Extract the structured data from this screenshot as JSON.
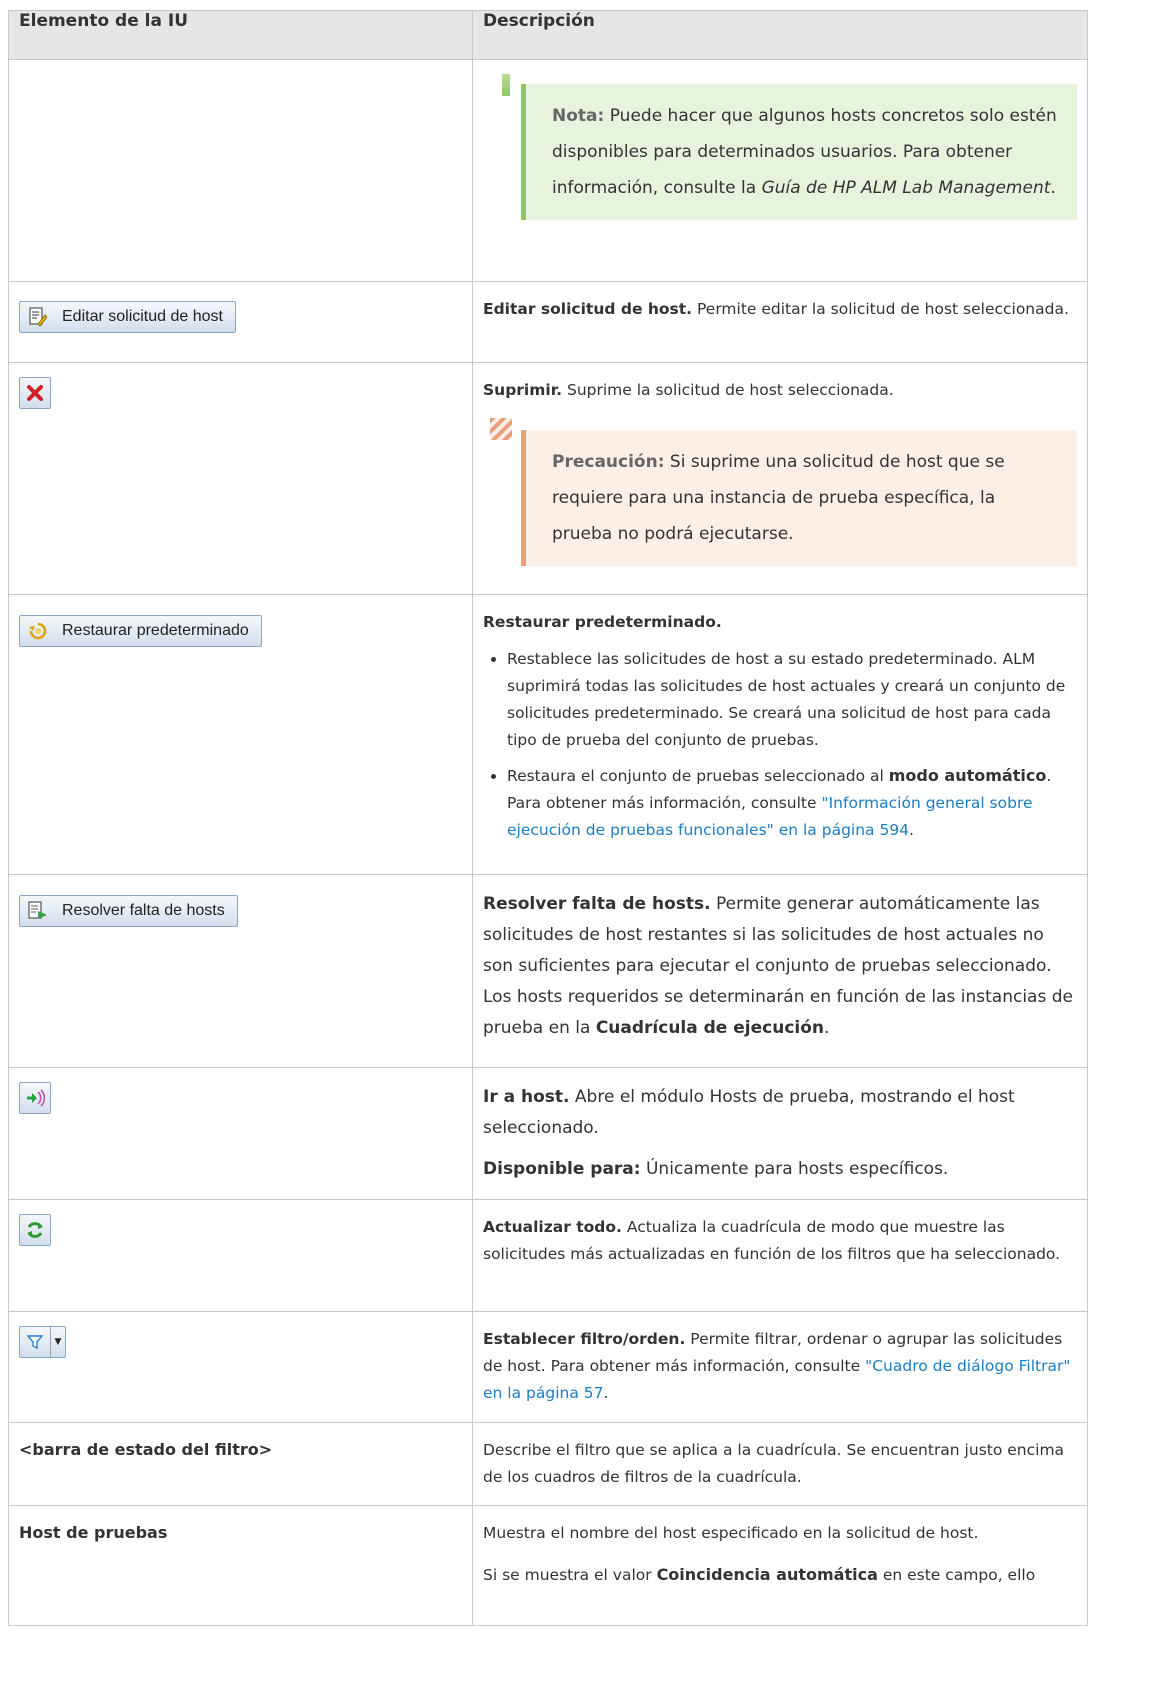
{
  "table": {
    "header": {
      "col1": "Elemento de la IU",
      "col2": "Descripción"
    },
    "note": {
      "label": "Nota:",
      "text1": "Puede hacer que algunos hosts concretos solo estén disponibles para determinados usuarios. Para obtener información, consulte la",
      "guide": "Guía de HP ALM Lab Management",
      "text2": "."
    },
    "edit": {
      "button_label": "Editar solicitud de host",
      "title": "Editar solicitud de host.",
      "text": "Permite editar la solicitud de host seleccionada."
    },
    "delete": {
      "title": "Suprimir.",
      "text": "Suprime la solicitud de host seleccionada.",
      "caution_label": "Precaución:",
      "caution_text": "Si suprime una solicitud de host que se requiere para una instancia de prueba específica, la prueba no podrá ejecutarse."
    },
    "restore": {
      "button_label": "Restaurar predeterminado",
      "title": "Restaurar predeterminado.",
      "bullet1": "Restablece las solicitudes de host a su estado predeterminado. ALM suprimirá todas las solicitudes de host actuales y creará un conjunto de solicitudes predeterminado. Se creará una solicitud de host para cada tipo de prueba del conjunto de pruebas.",
      "bullet2_pre": "Restaura el conjunto de pruebas seleccionado al",
      "bullet2_bold": "modo automático",
      "bullet2_mid": ". Para obtener más información, consulte",
      "bullet2_link": "\"Información general sobre ejecución de pruebas funcionales\" en la página 594",
      "bullet2_end": "."
    },
    "resolve": {
      "button_label": "Resolver falta de hosts",
      "title": "Resolver falta de hosts.",
      "text": "Permite generar automáticamente las solicitudes de host restantes si las solicitudes de host actuales no son suficientes para ejecutar el conjunto de pruebas seleccionado. Los hosts requeridos se determinarán en función de las instancias de prueba en la",
      "bold": "Cuadrícula de ejecución",
      "end": "."
    },
    "goto": {
      "title": "Ir a host.",
      "text": "Abre el módulo Hosts de prueba, mostrando el host seleccionado.",
      "avail_label": "Disponible para:",
      "avail_text": "Únicamente para hosts específicos."
    },
    "refresh": {
      "title": "Actualizar todo.",
      "text": "Actualiza la cuadrícula de modo que muestre las solicitudes más actualizadas en función de los filtros que ha seleccionado."
    },
    "filter": {
      "title": "Establecer filtro/orden.",
      "text": "Permite filtrar, ordenar o agrupar las solicitudes de host. Para obtener más información, consulte",
      "link": "\"Cuadro de diálogo Filtrar\" en la página 57",
      "end": "."
    },
    "statusbar": {
      "label": "<barra de estado del filtro>",
      "text": "Describe el filtro que se aplica a la cuadrícula. Se encuentran justo encima de los cuadros de filtros de la cuadrícula."
    },
    "testhost": {
      "label": "Host de pruebas",
      "text1": "Muestra el nombre del host especificado en la solicitud de host.",
      "text2_pre": "Si se muestra el valor",
      "text2_bold": "Coincidencia automática",
      "text2_post": "en este campo, ello"
    }
  },
  "icons": {
    "edit": "edit-document-icon",
    "delete": "red-x-delete-icon",
    "restore": "restore-default-icon",
    "resolve": "resolve-hosts-icon",
    "goto": "go-to-host-icon",
    "refresh": "refresh-icon",
    "filter": "filter-funnel-icon"
  },
  "colors": {
    "header_bg": "#e6e6e6",
    "link": "#1a7ec4",
    "note_bg": "#e8f3de",
    "note_border": "#8dc468",
    "caution_bg": "#fdeee6",
    "caution_border": "#e8a07c"
  }
}
